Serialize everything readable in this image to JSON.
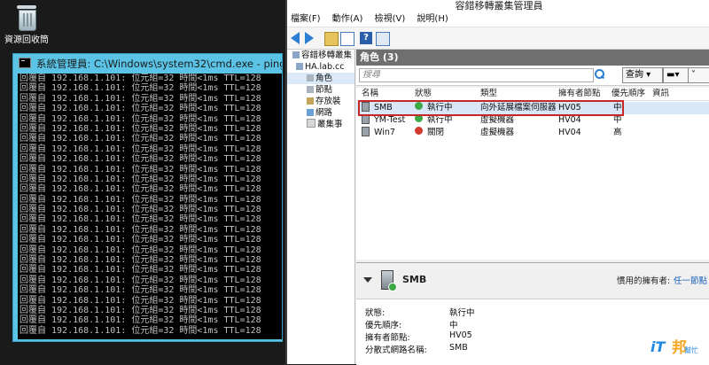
{
  "desktop": {
    "recycle_bin_label": "資源回收筒"
  },
  "cmd": {
    "title": "系統管理員: C:\\Windows\\system32\\cmd.exe - ping",
    "line": "回覆自 192.168.1.101: 位元組=32 時間<1ms TTL=128",
    "line_count": 26
  },
  "fcm": {
    "title": "容錯移轉叢集管理員",
    "menu": [
      "檔案(F)",
      "動作(A)",
      "檢視(V)",
      "說明(H)"
    ],
    "tree": [
      {
        "label": "容錯移轉叢集"
      },
      {
        "label": "HA.lab.cc"
      },
      {
        "label": "角色"
      },
      {
        "label": "節點"
      },
      {
        "label": "存放裝"
      },
      {
        "label": "網路"
      },
      {
        "label": "叢集事"
      }
    ],
    "roles_header": "角色 (3)",
    "search_placeholder": "搜尋",
    "query_button": "查詢",
    "columns": [
      "名稱",
      "狀態",
      "類型",
      "擁有者節點",
      "優先順序",
      "資訊"
    ],
    "rows": [
      {
        "name": "SMB",
        "status": "執行中",
        "type": "向外延展檔案伺服器",
        "owner": "HV05",
        "priority": "中",
        "status_color": "#3aa845"
      },
      {
        "name": "YM-Test",
        "status": "執行中",
        "type": "虛擬機器",
        "owner": "HV04",
        "priority": "中",
        "status_color": "#3aa845"
      },
      {
        "name": "Win7",
        "status": "關閉",
        "type": "虛擬機器",
        "owner": "HV04",
        "priority": "高",
        "status_color": "#d23a2e"
      }
    ],
    "detail": {
      "name": "SMB",
      "preferred_owner_label": "慣用的擁有者:",
      "preferred_owner_value": "任一節點",
      "fields": [
        {
          "label": "狀態:",
          "value": "執行中"
        },
        {
          "label": "優先順序:",
          "value": "中"
        },
        {
          "label": "擁有者節點:",
          "value": "HV05"
        },
        {
          "label": "分散式網路名稱:",
          "value": "SMB"
        }
      ]
    }
  },
  "watermark": {
    "brand": "iT",
    "bang": "邦",
    "sub": "幫忙"
  },
  "colors": {
    "cmd_frame": "#5ac3e6",
    "highlight": "#c62828",
    "running": "#3aa845",
    "stopped": "#d23a2e"
  }
}
